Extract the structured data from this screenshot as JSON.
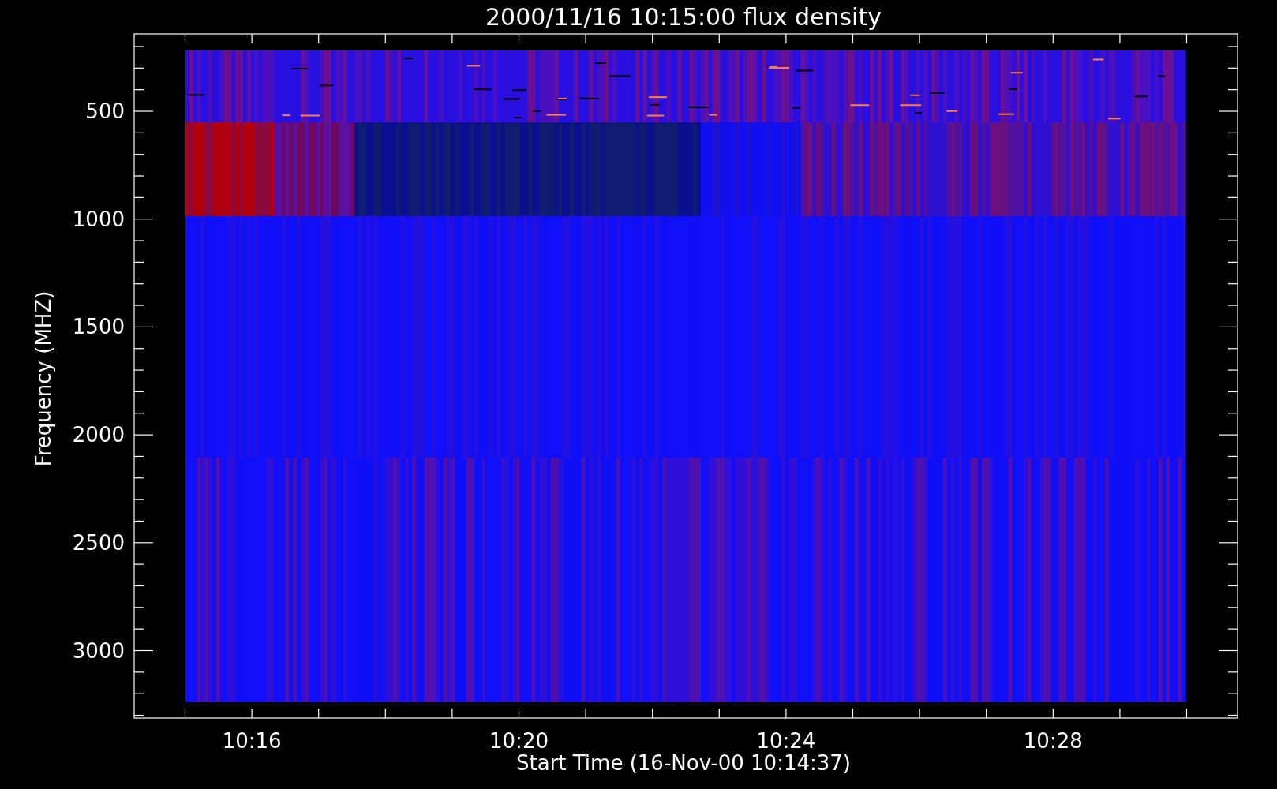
{
  "title": "2000/11/16 10:15:00 flux density",
  "y_axis": {
    "label": "Frequency (MHZ)",
    "ticks": [
      "500",
      "1000",
      "1500",
      "2000",
      "2500",
      "3000"
    ]
  },
  "x_axis": {
    "label": "Start Time (16-Nov-00 10:14:37)",
    "ticks": [
      "10:16",
      "10:20",
      "10:24",
      "10:28"
    ]
  }
}
